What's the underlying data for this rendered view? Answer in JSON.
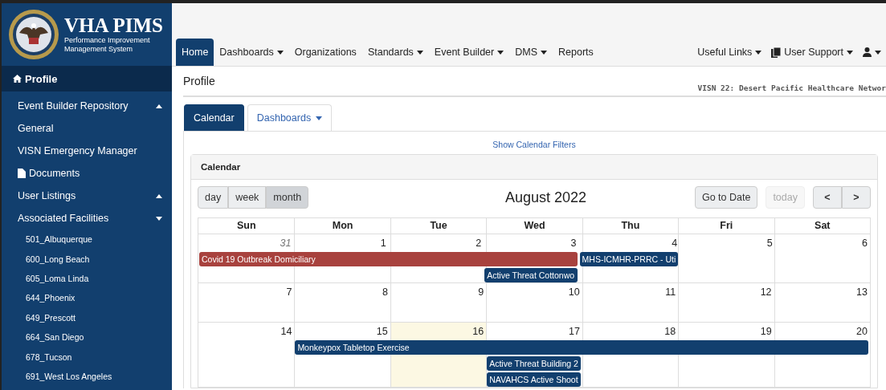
{
  "logo": {
    "title": "VHA PIMS",
    "subtitle_1": "Performance Improvement",
    "subtitle_2": "Management System"
  },
  "sidebar": {
    "items": [
      {
        "kind": "header",
        "label": "Profile",
        "selected": true
      },
      {
        "kind": "group",
        "label": "Event Builder Repository",
        "expanded": false
      },
      {
        "kind": "link",
        "label": "General"
      },
      {
        "kind": "link",
        "label": "VISN Emergency Manager"
      },
      {
        "kind": "doc",
        "label": "Documents"
      },
      {
        "kind": "group",
        "label": "User Listings",
        "expanded": false
      },
      {
        "kind": "group",
        "label": "Associated Facilities",
        "expanded": true,
        "children": [
          {
            "label": "501_Albuquerque"
          },
          {
            "label": "600_Long Beach"
          },
          {
            "label": "605_Loma Linda"
          },
          {
            "label": "644_Phoenix"
          },
          {
            "label": "649_Prescott"
          },
          {
            "label": "664_San Diego"
          },
          {
            "label": "678_Tucson"
          },
          {
            "label": "691_West Los Angeles"
          }
        ]
      }
    ]
  },
  "navbar": {
    "items": [
      {
        "label": "Home",
        "selected": true,
        "dropdown": false
      },
      {
        "label": "Dashboards",
        "selected": false,
        "dropdown": true
      },
      {
        "label": "Organizations",
        "selected": false,
        "dropdown": false
      },
      {
        "label": "Standards",
        "selected": false,
        "dropdown": true
      },
      {
        "label": "Event Builder",
        "selected": false,
        "dropdown": true
      },
      {
        "label": "DMS",
        "selected": false,
        "dropdown": true
      },
      {
        "label": "Reports",
        "selected": false,
        "dropdown": false
      }
    ],
    "right_items": [
      {
        "kind": "text",
        "label": "Useful Links"
      },
      {
        "kind": "support",
        "label": "User Support"
      },
      {
        "kind": "user"
      }
    ]
  },
  "page": {
    "title": "Profile",
    "network": "VISN 22: Desert Pacific Healthcare Networ"
  },
  "tabs": [
    {
      "label": "Calendar",
      "selected": true,
      "dropdown": false
    },
    {
      "label": "Dashboards",
      "selected": false,
      "dropdown": true
    }
  ],
  "filters_link": "Show Calendar Filters",
  "calendar": {
    "panel_title": "Calendar",
    "month": "August 2022",
    "views": [
      {
        "label": "day",
        "selected": false
      },
      {
        "label": "week",
        "selected": false
      },
      {
        "label": "month",
        "selected": true
      }
    ],
    "go_to_date": "Go to Date",
    "today": {
      "label": "today",
      "disabled": true
    },
    "prev": "<",
    "next": ">",
    "weekdays": [
      "Sun",
      "Mon",
      "Tue",
      "Wed",
      "Thu",
      "Fri",
      "Sat"
    ],
    "weeks": [
      {
        "days": [
          {
            "number": "31",
            "other_month": true,
            "today": false
          },
          {
            "number": "1",
            "other_month": false,
            "today": false
          },
          {
            "number": "2",
            "other_month": false,
            "today": false
          },
          {
            "number": "3",
            "other_month": false,
            "today": false
          },
          {
            "number": "4",
            "other_month": false,
            "today": false
          },
          {
            "number": "5",
            "other_month": false,
            "today": false
          },
          {
            "number": "6",
            "other_month": false,
            "today": false
          }
        ],
        "lanes": [
          [
            {
              "kind": "event",
              "title": "Covid 19 Outbreak Domiciliary",
              "color": "#a8423e"
            },
            {
              "kind": "continue"
            },
            {
              "kind": "continue"
            },
            {
              "kind": "continue"
            },
            {
              "kind": "event",
              "title": "MHS-ICMHR-PRRC - Uti",
              "color": "#123f6e"
            },
            {
              "kind": "empty"
            },
            {
              "kind": "empty"
            }
          ],
          [
            {
              "kind": "empty"
            },
            {
              "kind": "empty"
            },
            {
              "kind": "empty"
            },
            {
              "kind": "event",
              "title": "Active Threat Cottonwo",
              "color": "#123f6e"
            },
            {
              "kind": "empty"
            },
            {
              "kind": "empty"
            },
            {
              "kind": "empty"
            }
          ]
        ]
      },
      {
        "days": [
          {
            "number": "7",
            "other_month": false,
            "today": false
          },
          {
            "number": "8",
            "other_month": false,
            "today": false
          },
          {
            "number": "9",
            "other_month": false,
            "today": false
          },
          {
            "number": "10",
            "other_month": false,
            "today": false
          },
          {
            "number": "11",
            "other_month": false,
            "today": false
          },
          {
            "number": "12",
            "other_month": false,
            "today": false
          },
          {
            "number": "13",
            "other_month": false,
            "today": false
          }
        ]
      },
      {
        "days": [
          {
            "number": "14",
            "other_month": false,
            "today": false
          },
          {
            "number": "15",
            "other_month": false,
            "today": false
          },
          {
            "number": "16",
            "other_month": false,
            "today": true
          },
          {
            "number": "17",
            "other_month": false,
            "today": false
          },
          {
            "number": "18",
            "other_month": false,
            "today": false
          },
          {
            "number": "19",
            "other_month": false,
            "today": false
          },
          {
            "number": "20",
            "other_month": false,
            "today": false
          }
        ],
        "lanes": [
          [
            {
              "kind": "empty"
            },
            {
              "kind": "event",
              "title": "Monkeypox Tabletop Exercise",
              "color": "#123f6e"
            },
            {
              "kind": "continue"
            },
            {
              "kind": "continue"
            },
            {
              "kind": "continue"
            },
            {
              "kind": "continue"
            },
            {
              "kind": "continue"
            }
          ],
          [
            {
              "kind": "empty"
            },
            {
              "kind": "empty"
            },
            {
              "kind": "empty"
            },
            {
              "kind": "event",
              "title": "Active Threat Building 2",
              "color": "#123f6e"
            },
            {
              "kind": "empty"
            },
            {
              "kind": "empty"
            },
            {
              "kind": "empty"
            }
          ],
          [
            {
              "kind": "empty"
            },
            {
              "kind": "empty"
            },
            {
              "kind": "empty"
            },
            {
              "kind": "event",
              "title": "NAVAHCS Active Shoot",
              "color": "#123f6e"
            },
            {
              "kind": "empty"
            },
            {
              "kind": "empty"
            },
            {
              "kind": "empty"
            }
          ]
        ]
      }
    ]
  }
}
